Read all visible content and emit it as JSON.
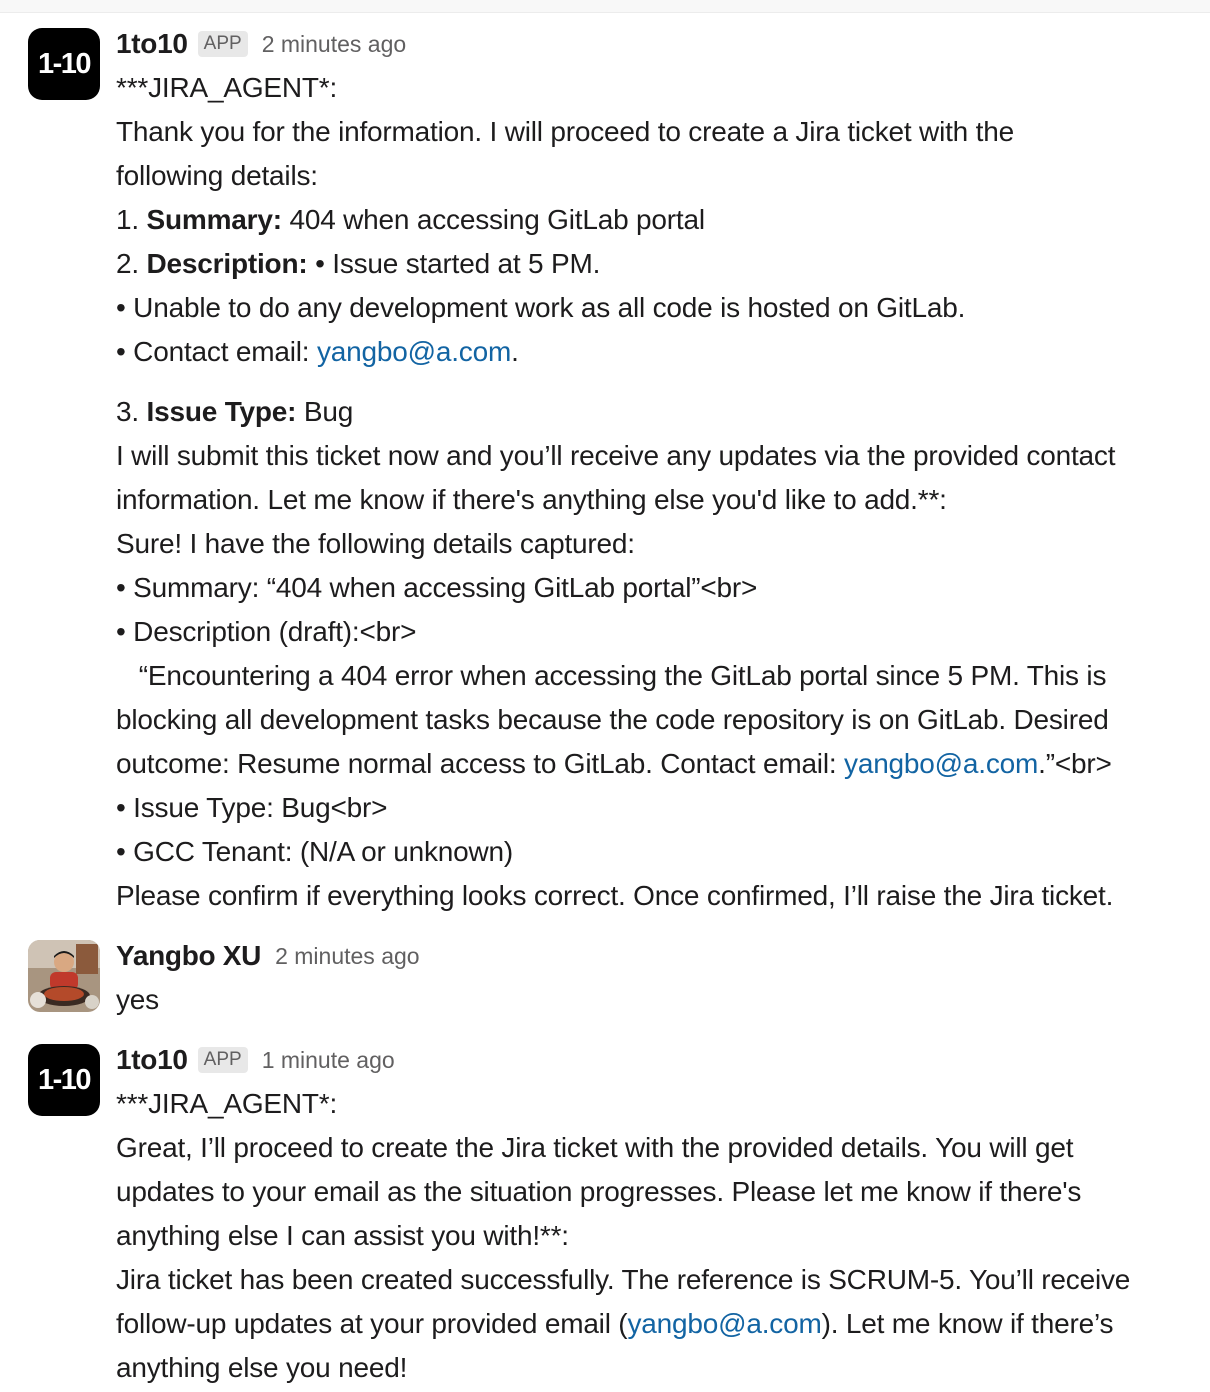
{
  "messages": [
    {
      "sender": "1to10",
      "avatar_text": "1-10",
      "badge": "APP",
      "time": "2 minutes ago",
      "lines": {
        "l1": "***JIRA_AGENT*:",
        "l2": "Thank you for the information. I will proceed to create a Jira ticket with the",
        "l3": "following details:",
        "l4_num": "1. ",
        "l4_bold": "Summary:",
        "l4_rest": " 404 when accessing GitLab portal",
        "l5_num": "2. ",
        "l5_bold": "Description:",
        "l5_rest": "  • Issue started at 5 PM.",
        "l6": "• Unable to do any development work as all code is hosted on GitLab.",
        "l7_pre": "• Contact email: ",
        "l7_link": "yangbo@a.com",
        "l7_post": ".",
        "l8_num": "3. ",
        "l8_bold": "Issue Type:",
        "l8_rest": " Bug",
        "l9": "I will submit this ticket now and you’ll receive any updates via the provided contact",
        "l10": "information. Let me know if there's anything else you'd like to add.**:",
        "l11": "Sure! I have the following details captured:",
        "l12": "• Summary: “404 when accessing GitLab portal”<br>",
        "l13": "• Description (draft):<br>",
        "l14": "   “Encountering a 404 error when accessing the GitLab portal since 5 PM. This is",
        "l15": "blocking all development tasks because the code repository is on GitLab. Desired",
        "l16_pre": "outcome: Resume normal access to GitLab. Contact email: ",
        "l16_link": "yangbo@a.com",
        "l16_post": ".”<br>",
        "l17": "• Issue Type: Bug<br>",
        "l18": "• GCC Tenant: (N/A or unknown)",
        "l19": "Please confirm if everything looks correct. Once confirmed, I’ll raise the Jira ticket."
      }
    },
    {
      "sender": "Yangbo XU",
      "time": "2 minutes ago",
      "lines": {
        "l1": "yes"
      }
    },
    {
      "sender": "1to10",
      "avatar_text": "1-10",
      "badge": "APP",
      "time": "1 minute ago",
      "lines": {
        "l1": "***JIRA_AGENT*:",
        "l2": "Great, I’ll proceed to create the Jira ticket with the provided details. You will get",
        "l3": "updates to your email as the situation progresses. Please let me know if there's",
        "l4": "anything else I can assist you with!**:",
        "l5": "Jira ticket has been created successfully. The reference is SCRUM-5. You’ll receive",
        "l6_pre": "follow-up updates at your provided email (",
        "l6_link": "yangbo@a.com",
        "l6_post": "). Let me know if there’s",
        "l7": "anything else you need!"
      }
    }
  ]
}
